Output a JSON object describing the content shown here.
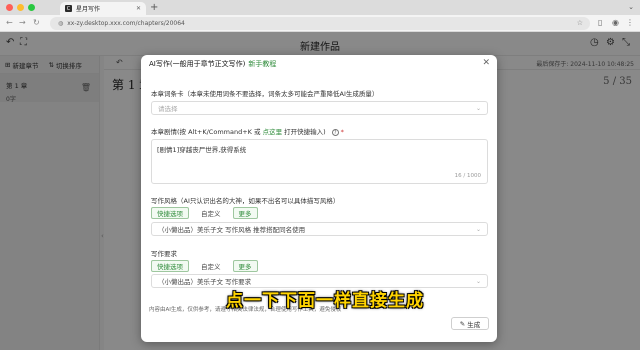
{
  "browser": {
    "tab_title": "星月写作",
    "favicon_text": "C",
    "url": "xx-zy.desktop.xxx.com/chapters/20064",
    "new_tab": "+",
    "traffic_colors": [
      "#ff5f57",
      "#febc2e",
      "#28c840"
    ]
  },
  "app": {
    "page_title": "新建作品",
    "left_actions": {
      "new_chapter": "新建章节",
      "toggle_sort": "切换排序"
    },
    "chapter": {
      "name": "第 1 章",
      "word_count": "0字"
    },
    "last_saved": "最后保存于: 2024-11-10 10:48:25",
    "editor_heading": "第 1 章",
    "page_counter": "5 / 35"
  },
  "modal": {
    "title": "AI写作(一般用于章节正文写作)",
    "guide_link": "新手教程",
    "cards_label": "本章词条卡（本章未使用词条不要选择，词条太多可能会严重降低AI生成质量）",
    "cards_placeholder": "请选择",
    "plot_label_prefix": "本章剧情(按 Alt+K/Command+K 或 ",
    "plot_label_link": "点这里",
    "plot_label_suffix": " 打开快捷输入)",
    "plot_required": "*",
    "plot_text": "[剧情1]穿越丧尸世界,获得系统",
    "plot_counter": "16 / 1000",
    "style_label": "写作风格（AI只认识出名的大神，如果不出名可以具体描写风格）",
    "style_buttons": [
      "快捷选项",
      "自定义",
      "更多"
    ],
    "style_value": "（小懒出品）美乐子文 写作风格 推荐搭配同名使用",
    "req_label": "写作要求",
    "req_buttons": [
      "快捷选项",
      "自定义",
      "更多"
    ],
    "req_value": "（小懒出品）美乐子文 写作要求",
    "footer_note": "内容由AI生成，仅供参考，请遵守相关法律法规，合理使用写作工具，避免侵权",
    "generate_label": "生成"
  },
  "overlay_caption": "点一下下面一样直接生成",
  "colors": {
    "accent_green": "#2e8b3a",
    "caption_yellow": "#ffd400"
  }
}
